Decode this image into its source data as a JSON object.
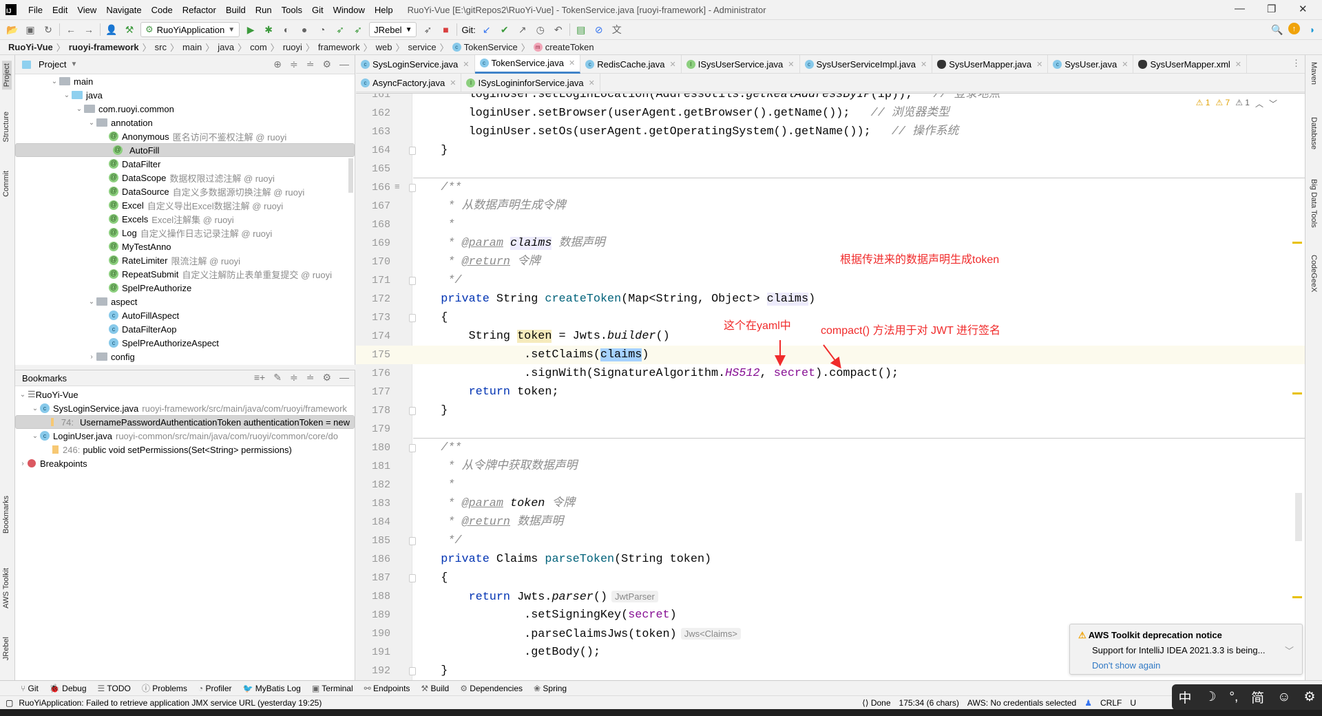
{
  "titlebar": {
    "menus": [
      "File",
      "Edit",
      "View",
      "Navigate",
      "Code",
      "Refactor",
      "Build",
      "Run",
      "Tools",
      "Git",
      "Window",
      "Help"
    ],
    "title": "RuoYi-Vue [E:\\gitRepos2\\RuoYi-Vue] - TokenService.java [ruoyi-framework] - Administrator"
  },
  "toolbar": {
    "run_config": "RuoYiApplication",
    "jrebel": "JRebel",
    "git_label": "Git:"
  },
  "breadcrumb": [
    "RuoYi-Vue",
    "ruoyi-framework",
    "src",
    "main",
    "java",
    "com",
    "ruoyi",
    "framework",
    "web",
    "service",
    "TokenService",
    "createToken"
  ],
  "left_strip": [
    "Project",
    "Structure",
    "Commit",
    "Bookmarks",
    "AWS Toolkit",
    "JRebel"
  ],
  "right_strip": [
    "Maven",
    "Database",
    "Big Data Tools",
    "CodeGeeX"
  ],
  "project": {
    "title": "Project",
    "tree": [
      {
        "label": "main",
        "depth": 0,
        "type": "folder",
        "expanded": true
      },
      {
        "label": "java",
        "depth": 1,
        "type": "src",
        "expanded": true
      },
      {
        "label": "com.ruoyi.common",
        "depth": 2,
        "type": "package",
        "expanded": true
      },
      {
        "label": "annotation",
        "depth": 3,
        "type": "package",
        "expanded": true
      },
      {
        "label": "Anonymous",
        "note": "匿名访问不鉴权注解 @ ruoyi",
        "depth": 4,
        "type": "annotation"
      },
      {
        "label": "AutoFill",
        "depth": 4,
        "type": "annotation",
        "selected": true
      },
      {
        "label": "DataFilter",
        "depth": 4,
        "type": "annotation"
      },
      {
        "label": "DataScope",
        "note": "数据权限过滤注解 @ ruoyi",
        "depth": 4,
        "type": "annotation"
      },
      {
        "label": "DataSource",
        "note": "自定义多数据源切换注解 @ ruoyi",
        "depth": 4,
        "type": "annotation"
      },
      {
        "label": "Excel",
        "note": "自定义导出Excel数据注解 @ ruoyi",
        "depth": 4,
        "type": "annotation"
      },
      {
        "label": "Excels",
        "note": "Excel注解集 @ ruoyi",
        "depth": 4,
        "type": "annotation"
      },
      {
        "label": "Log",
        "note": "自定义操作日志记录注解 @ ruoyi",
        "depth": 4,
        "type": "annotation"
      },
      {
        "label": "MyTestAnno",
        "depth": 4,
        "type": "annotation"
      },
      {
        "label": "RateLimiter",
        "note": "限流注解 @ ruoyi",
        "depth": 4,
        "type": "annotation"
      },
      {
        "label": "RepeatSubmit",
        "note": "自定义注解防止表单重复提交 @ ruoyi",
        "depth": 4,
        "type": "annotation"
      },
      {
        "label": "SpelPreAuthorize",
        "depth": 4,
        "type": "annotation"
      },
      {
        "label": "aspect",
        "depth": 3,
        "type": "package",
        "expanded": true
      },
      {
        "label": "AutoFillAspect",
        "depth": 4,
        "type": "class"
      },
      {
        "label": "DataFilterAop",
        "depth": 4,
        "type": "class"
      },
      {
        "label": "SpelPreAuthorizeAspect",
        "depth": 4,
        "type": "class"
      },
      {
        "label": "config",
        "depth": 3,
        "type": "package",
        "expanded": false
      }
    ]
  },
  "bookmarks": {
    "title": "Bookmarks",
    "items": [
      {
        "label": "RuoYi-Vue",
        "depth": 0,
        "type": "list",
        "expanded": true
      },
      {
        "label": "SysLoginService.java",
        "note": "ruoyi-framework/src/main/java/com/ruoyi/framework",
        "depth": 1,
        "type": "class",
        "expanded": true
      },
      {
        "label": "UsernamePasswordAuthenticationToken authenticationToken = new",
        "line": "74:",
        "depth": 2,
        "type": "bookmark",
        "selected": true
      },
      {
        "label": "LoginUser.java",
        "note": "ruoyi-common/src/main/java/com/ruoyi/common/core/do",
        "depth": 1,
        "type": "class",
        "expanded": true
      },
      {
        "label": "public void setPermissions(Set<String> permissions)",
        "line": "246:",
        "depth": 2,
        "type": "bookmark"
      },
      {
        "label": "Breakpoints",
        "depth": 0,
        "type": "breakpoint",
        "expanded": false
      }
    ]
  },
  "tabs": {
    "row1": [
      {
        "label": "SysLoginService.java",
        "icon": "c"
      },
      {
        "label": "TokenService.java",
        "icon": "c",
        "active": true
      },
      {
        "label": "RedisCache.java",
        "icon": "c"
      },
      {
        "label": "ISysUserService.java",
        "icon": "i"
      },
      {
        "label": "SysUserServiceImpl.java",
        "icon": "c"
      },
      {
        "label": "SysUserMapper.java",
        "icon": "b"
      },
      {
        "label": "SysUser.java",
        "icon": "c"
      },
      {
        "label": "SysUserMapper.xml",
        "icon": "b"
      }
    ],
    "row2": [
      {
        "label": "AsyncFactory.java",
        "icon": "c"
      },
      {
        "label": "ISysLogininforService.java",
        "icon": "i"
      }
    ]
  },
  "editor": {
    "warnings": [
      "1",
      "7",
      "1"
    ],
    "current_line": 175,
    "lines": [
      {
        "n": "161",
        "t": [
          [
            "        loginUser.setLoginLocation(AddressUtils.",
            "p"
          ],
          [
            "getRealAddressByIP",
            "p it"
          ],
          [
            "(ip));   ",
            "p"
          ],
          [
            "// 登录地点",
            "cm"
          ]
        ]
      },
      {
        "n": "162",
        "t": [
          [
            "        loginUser.setBrowser(userAgent.getBrowser().getName());   ",
            "p"
          ],
          [
            "// 浏览器类型",
            "cm"
          ]
        ]
      },
      {
        "n": "163",
        "t": [
          [
            "        loginUser.setOs(userAgent.getOperatingSystem().getName());   ",
            "p"
          ],
          [
            "// 操作系统",
            "cm"
          ]
        ]
      },
      {
        "n": "164",
        "t": [
          [
            "    }",
            "p"
          ]
        ]
      },
      {
        "n": "165",
        "t": []
      },
      {
        "n": "166",
        "t": [
          [
            "    /**",
            "doc"
          ]
        ]
      },
      {
        "n": "167",
        "t": [
          [
            "     * 从数据声明生成令牌",
            "doc"
          ]
        ]
      },
      {
        "n": "168",
        "t": [
          [
            "     *",
            "doc"
          ]
        ]
      },
      {
        "n": "169",
        "t": [
          [
            "     * ",
            "doc"
          ],
          [
            "@param",
            "dtag"
          ],
          [
            " ",
            "doc"
          ],
          [
            "claims",
            "dpar hl"
          ],
          [
            " 数据声明",
            "doc"
          ]
        ]
      },
      {
        "n": "170",
        "t": [
          [
            "     * ",
            "doc"
          ],
          [
            "@return",
            "dtag"
          ],
          [
            " 令牌",
            "doc"
          ]
        ]
      },
      {
        "n": "171",
        "t": [
          [
            "     */",
            "doc"
          ]
        ]
      },
      {
        "n": "172",
        "t": [
          [
            "    ",
            "p"
          ],
          [
            "private",
            "kw"
          ],
          [
            " String ",
            "p"
          ],
          [
            "createToken",
            "fn"
          ],
          [
            "(Map<String, Object> ",
            "p"
          ],
          [
            "claims",
            "p hl"
          ],
          [
            ")",
            "p"
          ]
        ]
      },
      {
        "n": "173",
        "t": [
          [
            "    {",
            "p"
          ]
        ]
      },
      {
        "n": "174",
        "t": [
          [
            "        String ",
            "p"
          ],
          [
            "token",
            "p hlt"
          ],
          [
            " = Jwts.",
            "p"
          ],
          [
            "builder",
            "p it"
          ],
          [
            "()",
            "p"
          ]
        ]
      },
      {
        "n": "175",
        "t": [
          [
            "                .setClaims(",
            "p"
          ],
          [
            "claims",
            "p selw"
          ],
          [
            ")",
            "p"
          ]
        ]
      },
      {
        "n": "176",
        "t": [
          [
            "                .signWith(SignatureAlgorithm.",
            "p"
          ],
          [
            "HS512",
            "const"
          ],
          [
            ", ",
            "p"
          ],
          [
            "secret",
            "field"
          ],
          [
            ").compact();",
            "p"
          ]
        ]
      },
      {
        "n": "177",
        "t": [
          [
            "        ",
            "p"
          ],
          [
            "return",
            "kw"
          ],
          [
            " token;",
            "p"
          ]
        ]
      },
      {
        "n": "178",
        "t": [
          [
            "    }",
            "p"
          ]
        ]
      },
      {
        "n": "179",
        "t": []
      },
      {
        "n": "180",
        "t": [
          [
            "    /**",
            "doc"
          ]
        ]
      },
      {
        "n": "181",
        "t": [
          [
            "     * 从令牌中获取数据声明",
            "doc"
          ]
        ]
      },
      {
        "n": "182",
        "t": [
          [
            "     *",
            "doc"
          ]
        ]
      },
      {
        "n": "183",
        "t": [
          [
            "     * ",
            "doc"
          ],
          [
            "@param",
            "dtag"
          ],
          [
            " ",
            "doc"
          ],
          [
            "token",
            "dpar"
          ],
          [
            " 令牌",
            "doc"
          ]
        ]
      },
      {
        "n": "184",
        "t": [
          [
            "     * ",
            "doc"
          ],
          [
            "@return",
            "dtag"
          ],
          [
            " 数据声明",
            "doc"
          ]
        ]
      },
      {
        "n": "185",
        "t": [
          [
            "     */",
            "doc"
          ]
        ]
      },
      {
        "n": "186",
        "t": [
          [
            "    ",
            "p"
          ],
          [
            "private",
            "kw"
          ],
          [
            " Claims ",
            "p"
          ],
          [
            "parseToken",
            "fn"
          ],
          [
            "(String token)",
            "p"
          ]
        ]
      },
      {
        "n": "187",
        "t": [
          [
            "    {",
            "p"
          ]
        ]
      },
      {
        "n": "188",
        "t": [
          [
            "        ",
            "p"
          ],
          [
            "return",
            "kw"
          ],
          [
            " Jwts.",
            "p"
          ],
          [
            "parser",
            "p it"
          ],
          [
            "()",
            "p"
          ]
        ],
        "inlay": "JwtParser"
      },
      {
        "n": "189",
        "t": [
          [
            "                .setSigningKey(",
            "p"
          ],
          [
            "secret",
            "field"
          ],
          [
            ")",
            "p"
          ]
        ]
      },
      {
        "n": "190",
        "t": [
          [
            "                .parseClaimsJws(token)",
            "p"
          ]
        ],
        "inlay": "Jws<Claims>"
      },
      {
        "n": "191",
        "t": [
          [
            "                .getBody();",
            "p"
          ]
        ]
      },
      {
        "n": "192",
        "t": [
          [
            "    }",
            "p"
          ]
        ]
      }
    ]
  },
  "annotations": {
    "a1": "根据传进来的数据声明生成token",
    "a2": "这个在yaml中",
    "a3": "compact() 方法用于对 JWT 进行签名",
    "color": "#f02b2b"
  },
  "bottom_tools": [
    "Git",
    "Debug",
    "TODO",
    "Problems",
    "Profiler",
    "MyBatis Log",
    "Terminal",
    "Endpoints",
    "Build",
    "Dependencies",
    "Spring"
  ],
  "status": {
    "message": "RuoYiApplication: Failed to retrieve application JMX service URL (yesterday 19:25)",
    "done": "Done",
    "position": "175:34 (6 chars)",
    "aws": "AWS: No credentials selected",
    "eol": "CRLF",
    "enc": "U"
  },
  "notification": {
    "title": "AWS Toolkit deprecation notice",
    "body": "Support for IntelliJ IDEA 2021.3.3 is being...",
    "link": "Don't show again"
  },
  "ime": [
    "中",
    "☽",
    "°,",
    "简",
    "☺",
    "⚙"
  ]
}
